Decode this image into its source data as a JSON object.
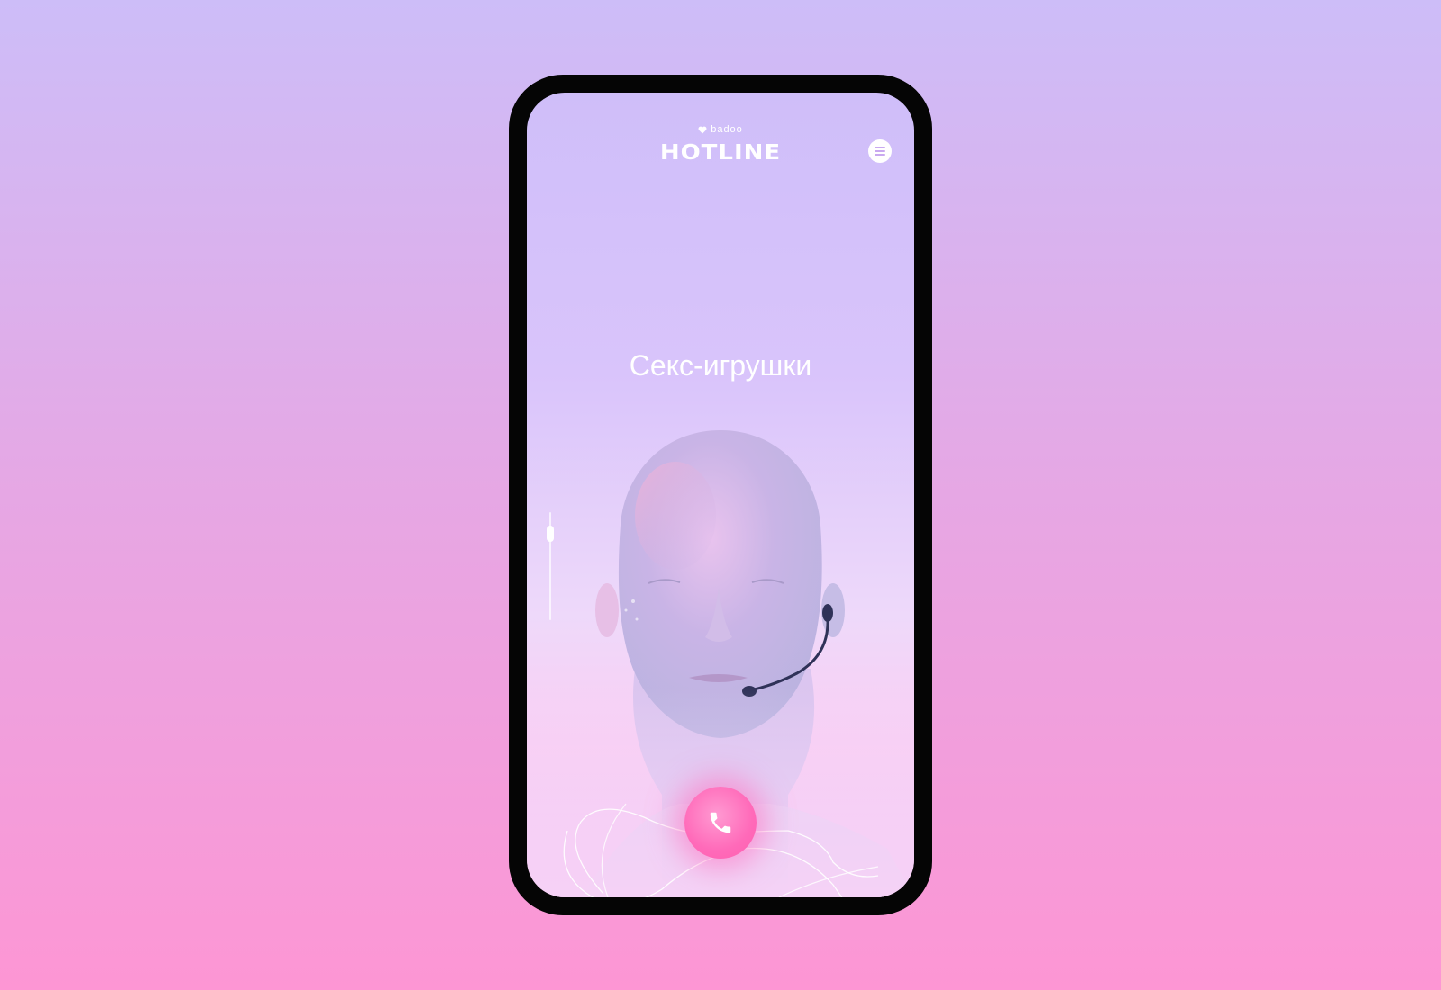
{
  "brand": {
    "small_label": "badoo",
    "logo_text": "HOTLINE"
  },
  "headline": "Секс-игрушки",
  "icons": {
    "menu": "hamburger-menu-icon",
    "call": "phone-icon",
    "brand": "heart-icon"
  },
  "slider": {
    "value": 0.15
  },
  "colors": {
    "accent": "#ff6ab9",
    "background_top": "#cdbdf8",
    "background_bottom": "#fd96d4",
    "phone_frame": "#050505"
  }
}
